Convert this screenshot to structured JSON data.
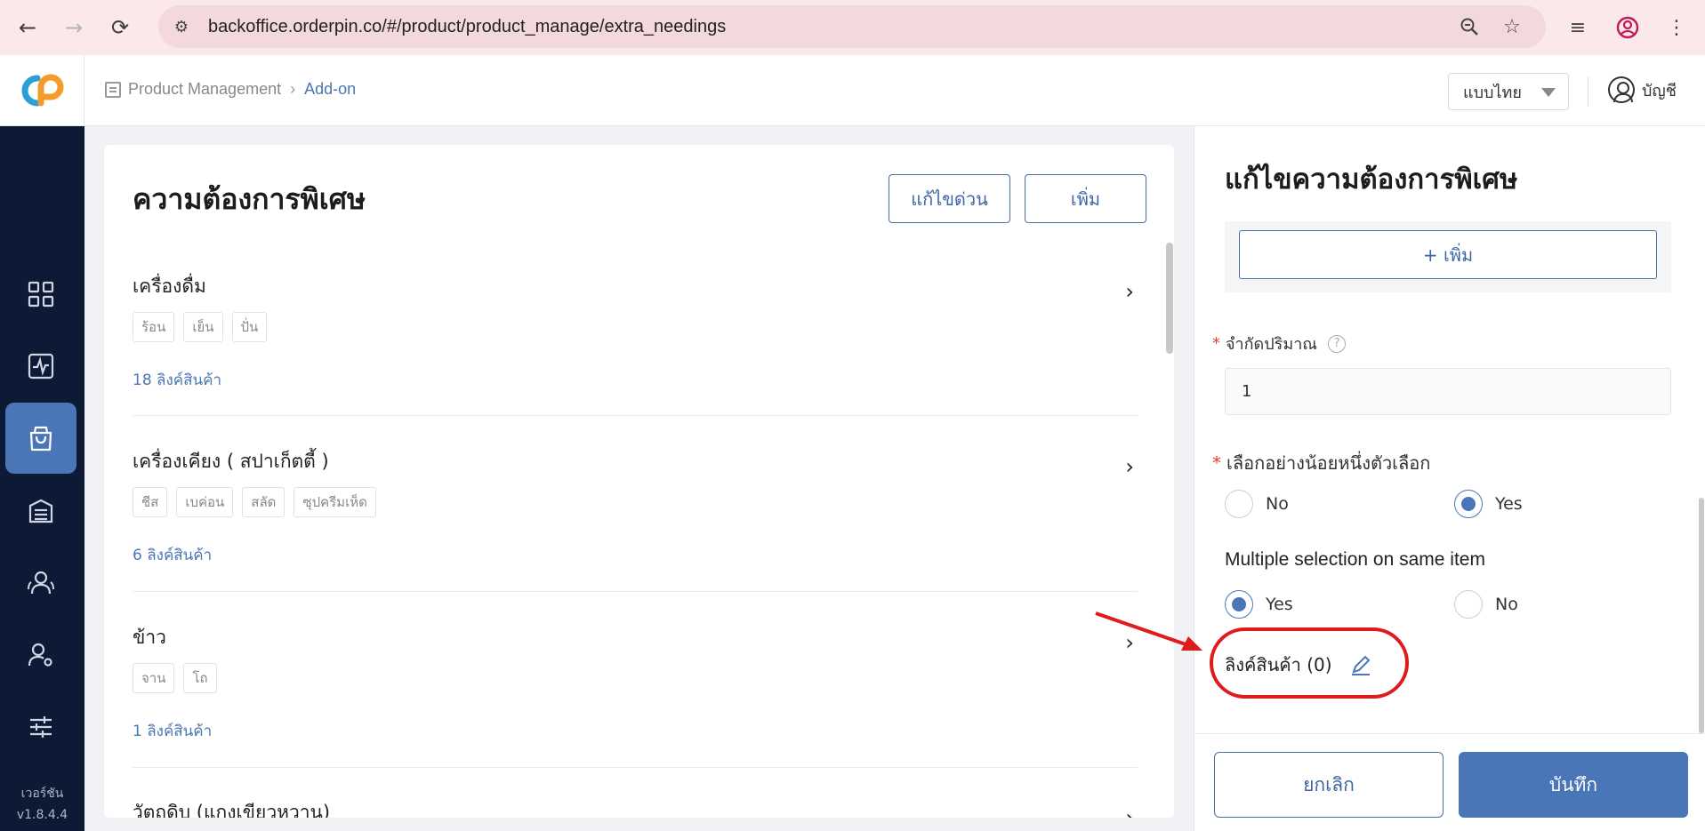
{
  "browser": {
    "url": "backoffice.orderpin.co/#/product/product_manage/extra_needings",
    "back_icon": "arrow-left-icon",
    "forward_icon": "arrow-right-icon",
    "reload_icon": "reload-icon"
  },
  "header": {
    "breadcrumb": {
      "parent": "Product Management",
      "current": "Add-on"
    },
    "language": "แบบไทย",
    "account_label": "บัญชี"
  },
  "sidebar": {
    "items": [
      {
        "icon": "grid-icon"
      },
      {
        "icon": "activity-icon"
      },
      {
        "icon": "shopping-bag-icon",
        "active": true
      },
      {
        "icon": "list-box-icon"
      },
      {
        "icon": "users-icon"
      },
      {
        "icon": "user-settings-icon"
      },
      {
        "icon": "sliders-icon"
      }
    ],
    "version_label": "เวอร์ชัน",
    "version": "v1.8.4.4"
  },
  "main": {
    "title": "ความต้องการพิเศษ",
    "quick_edit_label": "แก้ไขด่วน",
    "add_label": "เพิ่ม",
    "items": [
      {
        "name": "เครื่องดื่ม",
        "tags": [
          "ร้อน",
          "เย็น",
          "ปั่น"
        ],
        "link_count": "18 ลิงค์สินค้า"
      },
      {
        "name": "เครื่องเคียง ( สปาเก็ตตี้ )",
        "tags": [
          "ชีส",
          "เบค่อน",
          "สลัด",
          "ซุปครีมเห็ด"
        ],
        "link_count": "6 ลิงค์สินค้า"
      },
      {
        "name": "ข้าว",
        "tags": [
          "จาน",
          "โถ"
        ],
        "link_count": "1 ลิงค์สินค้า"
      },
      {
        "name": "วัตถดิบ (แกงเขียวหวาน)",
        "tags": [],
        "link_count": ""
      }
    ]
  },
  "panel": {
    "title": "แก้ไขความต้องการพิเศษ",
    "add_button": "+ เพิ่ม",
    "limit_label": "จำกัดปริมาณ",
    "limit_value": "1",
    "min_one_label": "เลือกอย่างน้อยหนึ่งตัวเลือก",
    "min_one_options": {
      "no": "No",
      "yes": "Yes",
      "selected": "Yes"
    },
    "multi_label": "Multiple selection on same item",
    "multi_options": {
      "yes": "Yes",
      "no": "No",
      "selected": "Yes"
    },
    "link_products_label": "ลิงค์สินค้า (0)",
    "cancel_label": "ยกเลิก",
    "save_label": "บันทึก"
  },
  "colors": {
    "primary": "#4a76b8",
    "sidebar_bg": "#0d1a36",
    "annotation": "#e01b1b"
  }
}
